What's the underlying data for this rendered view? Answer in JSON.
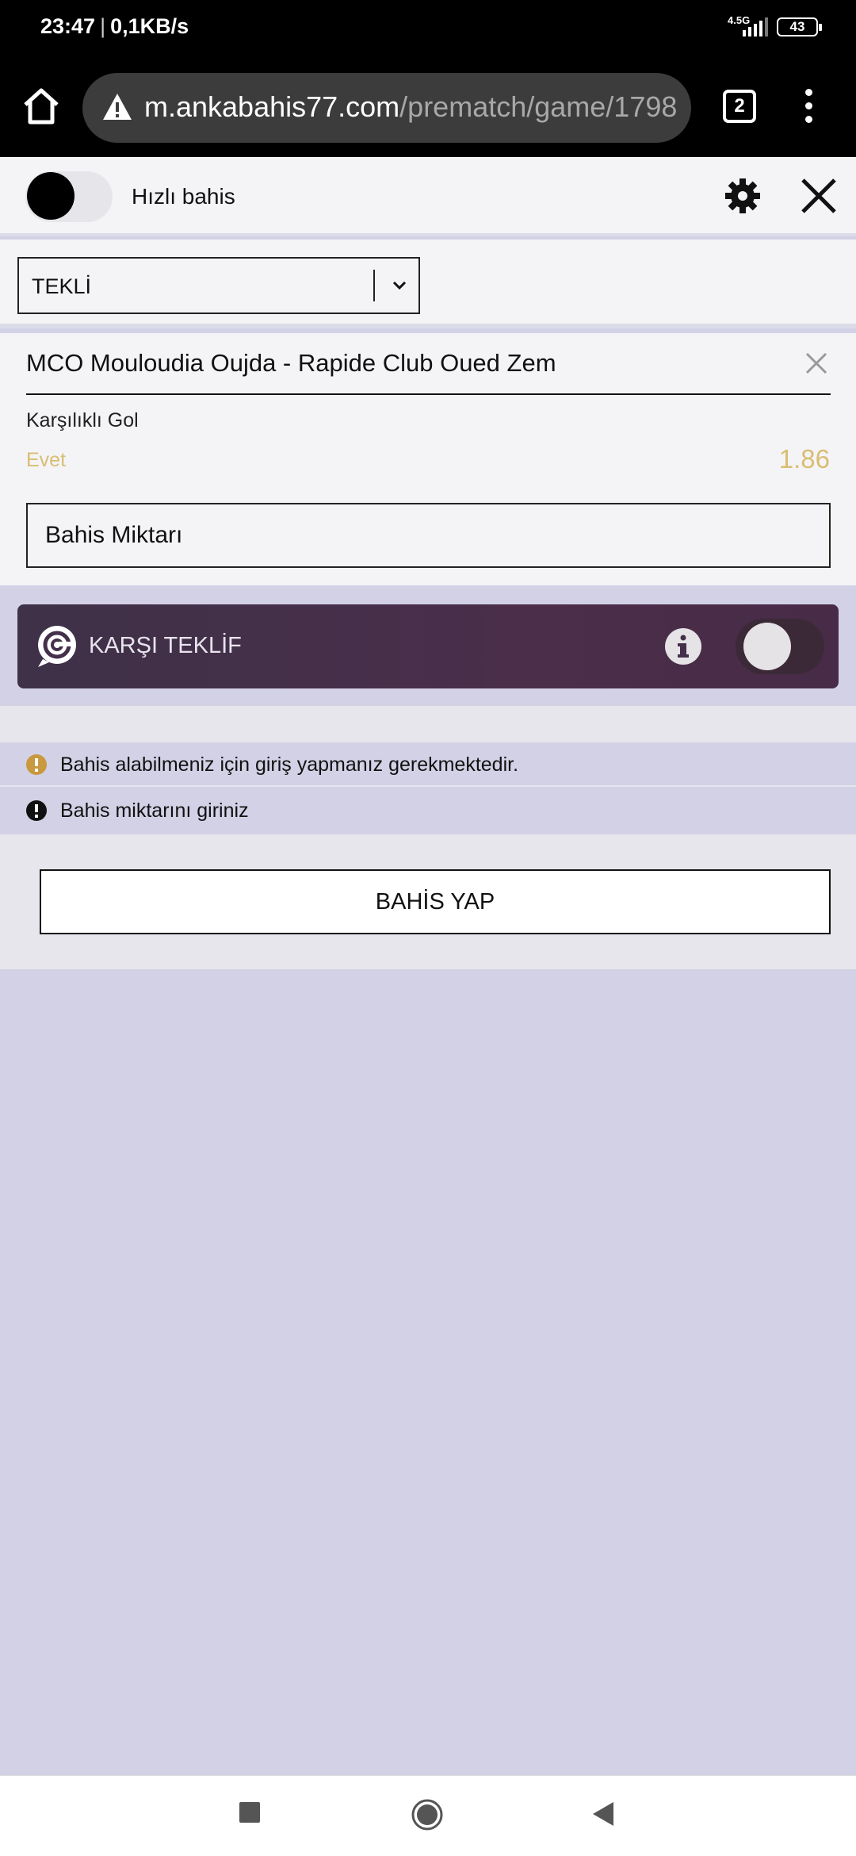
{
  "status": {
    "time": "23:47",
    "speed": "0,1KB/s",
    "network": "4.5G",
    "battery": "43"
  },
  "browser": {
    "url_domain": "m.ankabahis77.com",
    "url_path": "/prematch/game/1798",
    "tab_count": "2"
  },
  "betslip": {
    "quick_bet_label": "Hızlı bahis",
    "bet_type": "TEKLİ",
    "match": "MCO Mouloudia Oujda - Rapide Club Oued Zem",
    "market": "Karşılıklı Gol",
    "selection": "Evet",
    "odd": "1.86",
    "stake_placeholder": "Bahis Miktarı",
    "counter_offer_label": "KARŞI TEKLİF",
    "messages": [
      "Bahis alabilmeniz için giriş yapmanız gerekmektedir.",
      "Bahis miktarını giriniz"
    ],
    "place_bet_label": "BAHİS YAP"
  },
  "colors": {
    "accent_gold": "#d9bd72",
    "warning_orange": "#c8993e",
    "counter_bg": "#4a2e4a",
    "page_bg": "#d3d1e6"
  }
}
